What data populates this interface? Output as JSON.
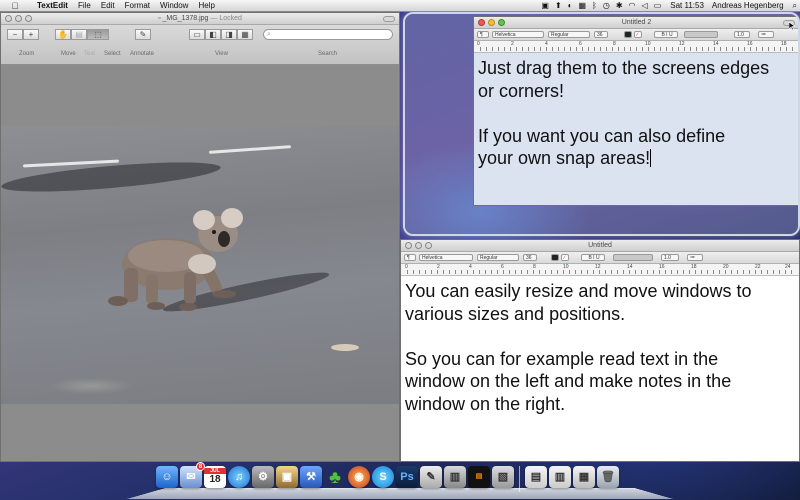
{
  "menubar": {
    "apple_glyph": "",
    "app_name": "TextEdit",
    "menus": [
      "File",
      "Edit",
      "Format",
      "Window",
      "Help"
    ],
    "clock": "Sat 11:53",
    "user": "Andreas Hegenberg",
    "search_glyph": "⌕"
  },
  "preview": {
    "title": "_MG_1378.jpg",
    "title_suffix": "— Locked",
    "toolbar_labels": {
      "zoom": "Zoom",
      "move": "Move",
      "text": "Text",
      "select": "Select",
      "annotate": "Annotate",
      "view": "View",
      "search": "Search"
    }
  },
  "textedit_2": {
    "title": "Untitled 2",
    "font": "Helvetica",
    "style": "Regular",
    "size": "36",
    "spacing": "1.0",
    "ruler": [
      "0",
      "2",
      "4",
      "6",
      "8",
      "10",
      "12",
      "14",
      "16",
      "18"
    ],
    "paragraphs": [
      "Just drag them to the screens edges",
      "or corners!",
      "",
      "If you want you can also define",
      "your own snap areas!"
    ]
  },
  "textedit_1": {
    "title": "Untitled",
    "font": "Helvetica",
    "style": "Regular",
    "size": "36",
    "spacing": "1.0",
    "ruler": [
      "0",
      "2",
      "4",
      "6",
      "8",
      "10",
      "12",
      "14",
      "16",
      "18",
      "20",
      "22",
      "24"
    ],
    "paragraphs": [
      "You can easily resize and move windows to",
      "various sizes and positions.",
      "",
      "So you can for example read text in the",
      "window on the left and make notes in the",
      "window on the right."
    ]
  },
  "dock": {
    "calendar_day": "18",
    "calendar_month": "JUL",
    "mail_badge": "8"
  }
}
